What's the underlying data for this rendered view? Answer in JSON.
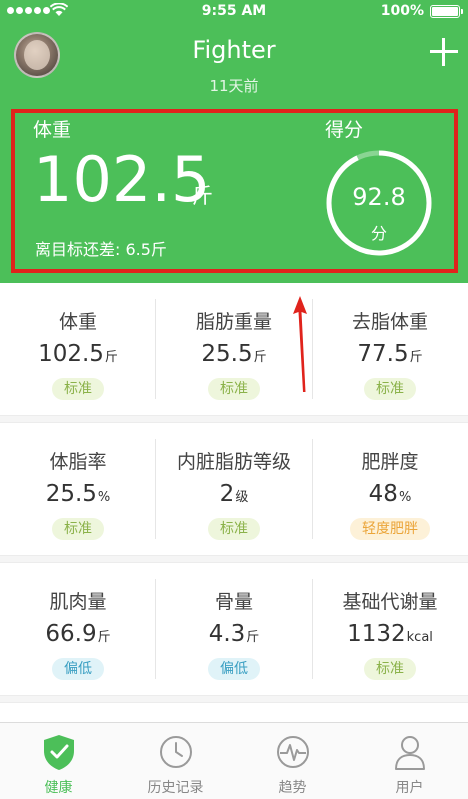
{
  "status": {
    "time": "9:55 AM",
    "battery": "100%"
  },
  "profile": {
    "name": "Fighter",
    "last_measured": "11天前"
  },
  "summary": {
    "weight_label": "体重",
    "weight_value": "102.5",
    "weight_unit": "斤",
    "goal_text": "离目标还差: 6.5斤",
    "score_label": "得分",
    "score_value": "92.8",
    "score_unit": "分",
    "score_progress": 0.928
  },
  "metrics": [
    {
      "label": "体重",
      "value": "102.5",
      "unit": "斤",
      "status": "标准",
      "level": "std"
    },
    {
      "label": "脂肪重量",
      "value": "25.5",
      "unit": "斤",
      "status": "标准",
      "level": "std"
    },
    {
      "label": "去脂体重",
      "value": "77.5",
      "unit": "斤",
      "status": "标准",
      "level": "std"
    },
    {
      "label": "体脂率",
      "value": "25.5",
      "unit": "%",
      "status": "标准",
      "level": "std"
    },
    {
      "label": "内脏脂肪等级",
      "value": "2",
      "unit": "级",
      "status": "标准",
      "level": "std"
    },
    {
      "label": "肥胖度",
      "value": "48",
      "unit": "%",
      "status": "轻度肥胖",
      "level": "over"
    },
    {
      "label": "肌肉量",
      "value": "66.9",
      "unit": "斤",
      "status": "偏低",
      "level": "low"
    },
    {
      "label": "骨量",
      "value": "4.3",
      "unit": "斤",
      "status": "偏低",
      "level": "low"
    },
    {
      "label": "基础代谢量",
      "value": "1132",
      "unit": "kcal",
      "status": "标准",
      "level": "std"
    }
  ],
  "tabs": [
    {
      "label": "健康",
      "icon": "shield-check-icon",
      "active": true
    },
    {
      "label": "历史记录",
      "icon": "clock-icon",
      "active": false
    },
    {
      "label": "趋势",
      "icon": "pulse-icon",
      "active": false
    },
    {
      "label": "用户",
      "icon": "user-icon",
      "active": false
    }
  ],
  "colors": {
    "primary": "#4cbf59",
    "highlight": "#e0231c"
  }
}
